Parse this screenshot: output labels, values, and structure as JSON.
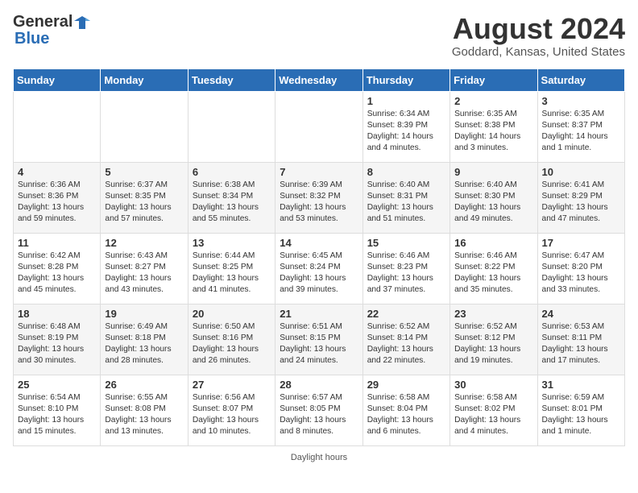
{
  "header": {
    "logo_general": "General",
    "logo_blue": "Blue",
    "month_title": "August 2024",
    "location": "Goddard, Kansas, United States"
  },
  "weekdays": [
    "Sunday",
    "Monday",
    "Tuesday",
    "Wednesday",
    "Thursday",
    "Friday",
    "Saturday"
  ],
  "footer": {
    "daylight_hours_label": "Daylight hours"
  },
  "weeks": [
    [
      {
        "day": "",
        "info": ""
      },
      {
        "day": "",
        "info": ""
      },
      {
        "day": "",
        "info": ""
      },
      {
        "day": "",
        "info": ""
      },
      {
        "day": "1",
        "info": "Sunrise: 6:34 AM\nSunset: 8:39 PM\nDaylight: 14 hours\nand 4 minutes."
      },
      {
        "day": "2",
        "info": "Sunrise: 6:35 AM\nSunset: 8:38 PM\nDaylight: 14 hours\nand 3 minutes."
      },
      {
        "day": "3",
        "info": "Sunrise: 6:35 AM\nSunset: 8:37 PM\nDaylight: 14 hours\nand 1 minute."
      }
    ],
    [
      {
        "day": "4",
        "info": "Sunrise: 6:36 AM\nSunset: 8:36 PM\nDaylight: 13 hours\nand 59 minutes."
      },
      {
        "day": "5",
        "info": "Sunrise: 6:37 AM\nSunset: 8:35 PM\nDaylight: 13 hours\nand 57 minutes."
      },
      {
        "day": "6",
        "info": "Sunrise: 6:38 AM\nSunset: 8:34 PM\nDaylight: 13 hours\nand 55 minutes."
      },
      {
        "day": "7",
        "info": "Sunrise: 6:39 AM\nSunset: 8:32 PM\nDaylight: 13 hours\nand 53 minutes."
      },
      {
        "day": "8",
        "info": "Sunrise: 6:40 AM\nSunset: 8:31 PM\nDaylight: 13 hours\nand 51 minutes."
      },
      {
        "day": "9",
        "info": "Sunrise: 6:40 AM\nSunset: 8:30 PM\nDaylight: 13 hours\nand 49 minutes."
      },
      {
        "day": "10",
        "info": "Sunrise: 6:41 AM\nSunset: 8:29 PM\nDaylight: 13 hours\nand 47 minutes."
      }
    ],
    [
      {
        "day": "11",
        "info": "Sunrise: 6:42 AM\nSunset: 8:28 PM\nDaylight: 13 hours\nand 45 minutes."
      },
      {
        "day": "12",
        "info": "Sunrise: 6:43 AM\nSunset: 8:27 PM\nDaylight: 13 hours\nand 43 minutes."
      },
      {
        "day": "13",
        "info": "Sunrise: 6:44 AM\nSunset: 8:25 PM\nDaylight: 13 hours\nand 41 minutes."
      },
      {
        "day": "14",
        "info": "Sunrise: 6:45 AM\nSunset: 8:24 PM\nDaylight: 13 hours\nand 39 minutes."
      },
      {
        "day": "15",
        "info": "Sunrise: 6:46 AM\nSunset: 8:23 PM\nDaylight: 13 hours\nand 37 minutes."
      },
      {
        "day": "16",
        "info": "Sunrise: 6:46 AM\nSunset: 8:22 PM\nDaylight: 13 hours\nand 35 minutes."
      },
      {
        "day": "17",
        "info": "Sunrise: 6:47 AM\nSunset: 8:20 PM\nDaylight: 13 hours\nand 33 minutes."
      }
    ],
    [
      {
        "day": "18",
        "info": "Sunrise: 6:48 AM\nSunset: 8:19 PM\nDaylight: 13 hours\nand 30 minutes."
      },
      {
        "day": "19",
        "info": "Sunrise: 6:49 AM\nSunset: 8:18 PM\nDaylight: 13 hours\nand 28 minutes."
      },
      {
        "day": "20",
        "info": "Sunrise: 6:50 AM\nSunset: 8:16 PM\nDaylight: 13 hours\nand 26 minutes."
      },
      {
        "day": "21",
        "info": "Sunrise: 6:51 AM\nSunset: 8:15 PM\nDaylight: 13 hours\nand 24 minutes."
      },
      {
        "day": "22",
        "info": "Sunrise: 6:52 AM\nSunset: 8:14 PM\nDaylight: 13 hours\nand 22 minutes."
      },
      {
        "day": "23",
        "info": "Sunrise: 6:52 AM\nSunset: 8:12 PM\nDaylight: 13 hours\nand 19 minutes."
      },
      {
        "day": "24",
        "info": "Sunrise: 6:53 AM\nSunset: 8:11 PM\nDaylight: 13 hours\nand 17 minutes."
      }
    ],
    [
      {
        "day": "25",
        "info": "Sunrise: 6:54 AM\nSunset: 8:10 PM\nDaylight: 13 hours\nand 15 minutes."
      },
      {
        "day": "26",
        "info": "Sunrise: 6:55 AM\nSunset: 8:08 PM\nDaylight: 13 hours\nand 13 minutes."
      },
      {
        "day": "27",
        "info": "Sunrise: 6:56 AM\nSunset: 8:07 PM\nDaylight: 13 hours\nand 10 minutes."
      },
      {
        "day": "28",
        "info": "Sunrise: 6:57 AM\nSunset: 8:05 PM\nDaylight: 13 hours\nand 8 minutes."
      },
      {
        "day": "29",
        "info": "Sunrise: 6:58 AM\nSunset: 8:04 PM\nDaylight: 13 hours\nand 6 minutes."
      },
      {
        "day": "30",
        "info": "Sunrise: 6:58 AM\nSunset: 8:02 PM\nDaylight: 13 hours\nand 4 minutes."
      },
      {
        "day": "31",
        "info": "Sunrise: 6:59 AM\nSunset: 8:01 PM\nDaylight: 13 hours\nand 1 minute."
      }
    ]
  ]
}
